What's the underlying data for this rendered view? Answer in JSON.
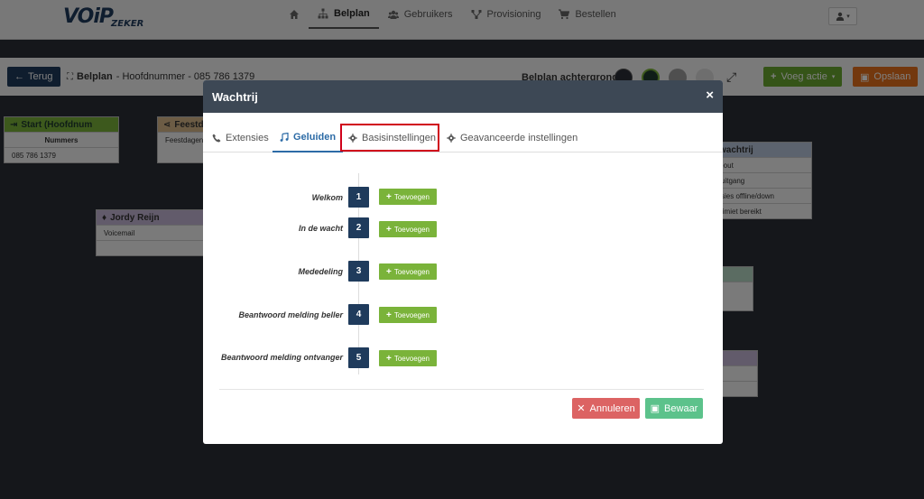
{
  "logo": {
    "voip": "VOiP",
    "zeker": "ZEKER"
  },
  "nav": {
    "items": [
      {
        "label": "",
        "icon": "home-icon"
      },
      {
        "label": "Belplan",
        "icon": "sitemap-icon",
        "active": true
      },
      {
        "label": "Gebruikers",
        "icon": "users-icon"
      },
      {
        "label": "Provisioning",
        "icon": "network-icon"
      },
      {
        "label": "Bestellen",
        "icon": "cart-icon"
      }
    ]
  },
  "toolbar": {
    "back_label": "Terug",
    "title_bold": "Belplan",
    "title_rest": "- Hoofdnummer - 085 786 1379",
    "background_label": "Belplan achtergrond",
    "swatches": [
      "#2b2e36",
      "#1f3b2e",
      "#9e9e9e",
      "#dcdcdc"
    ],
    "add_label": "Voeg actie",
    "save_label": "Opslaan"
  },
  "canvas": {
    "start": {
      "title": "Start (Hoofdnum",
      "row1": "Nummers",
      "row2": "085 786 1379"
    },
    "feestdag": {
      "title": "Feestda",
      "row1": "Feestdagen"
    },
    "jordy": {
      "title": "Jordy Reijn",
      "row1": "Voicemail"
    },
    "wachtrij": {
      "title": "wachtrij",
      "rows": [
        "-out",
        "uitgang",
        "sies offline/down",
        "limiet bereikt"
      ]
    }
  },
  "modal": {
    "title": "Wachtrij",
    "close": "×",
    "tabs": [
      {
        "label": "Extensies",
        "icon": "phone-icon"
      },
      {
        "label": "Geluiden",
        "icon": "music-icon",
        "active": true
      },
      {
        "label": "Basisinstellingen",
        "icon": "gear-icon",
        "highlighted": true
      },
      {
        "label": "Geavanceerde instellingen",
        "icon": "gear-icon"
      }
    ],
    "rows": [
      {
        "label": "Welkom",
        "num": "1",
        "button": "Toevoegen"
      },
      {
        "label": "In de wacht",
        "num": "2",
        "button": "Toevoegen"
      },
      {
        "label": "Mededeling",
        "num": "3",
        "button": "Toevoegen"
      },
      {
        "label": "Beantwoord melding beller",
        "num": "4",
        "button": "Toevoegen"
      },
      {
        "label": "Beantwoord melding ontvanger",
        "num": "5",
        "button": "Toevoegen"
      }
    ],
    "cancel_label": "Annuleren",
    "save_label": "Bewaar"
  },
  "colors": {
    "navy": "#1f3b5c",
    "green": "#7ab33a",
    "highlight_red": "#d0021b",
    "cancel_red": "#dc6363",
    "save_green": "#5cc28b"
  }
}
